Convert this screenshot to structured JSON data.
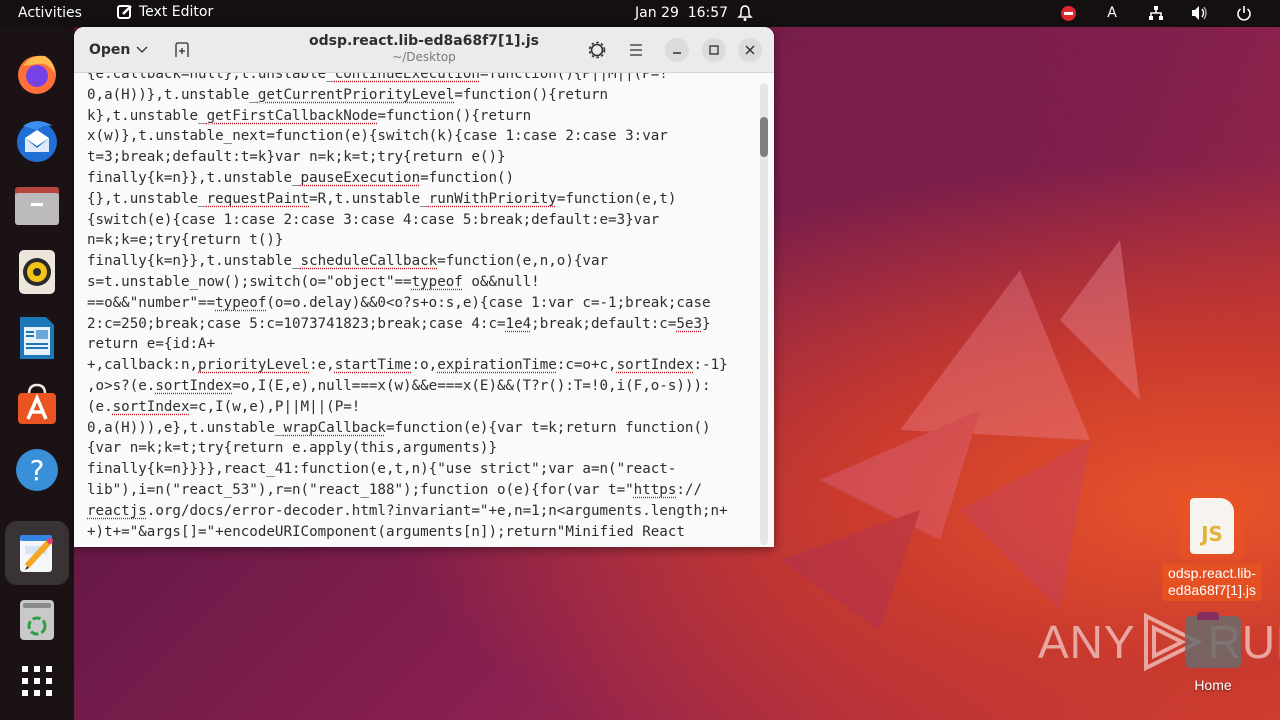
{
  "topbar": {
    "activities": "Activities",
    "app_name": "Text Editor",
    "datetime": "Jan 29  16:57",
    "tray": {
      "input_source": "A"
    }
  },
  "dock": {
    "items": [
      {
        "name": "Firefox",
        "icon": "firefox-icon"
      },
      {
        "name": "Thunderbird",
        "icon": "thunderbird-icon"
      },
      {
        "name": "Files",
        "icon": "files-icon"
      },
      {
        "name": "Rhythmbox",
        "icon": "rhythmbox-icon"
      },
      {
        "name": "LibreOffice Writer",
        "icon": "writer-icon"
      },
      {
        "name": "Ubuntu Software",
        "icon": "software-icon"
      },
      {
        "name": "Help",
        "icon": "help-icon"
      },
      {
        "name": "Text Editor",
        "icon": "text-editor-icon",
        "running": true,
        "active": true
      },
      {
        "name": "Trash",
        "icon": "trash-icon"
      },
      {
        "name": "Show Applications",
        "icon": "app-grid-icon"
      }
    ]
  },
  "window": {
    "open_label": "Open",
    "title": "odsp.react.lib-ed8a68f7[1].js",
    "subtitle": "~/Desktop",
    "scroll_position_fraction": 0.08
  },
  "editor": {
    "lines": [
      [
        {
          "t": "{e.callback=null},t.unstable_"
        },
        {
          "t": "continueExecution",
          "u": true
        },
        {
          "t": "=function(){P||M||(P=!"
        }
      ],
      [
        {
          "t": "0,a(H))},t.unstable_"
        },
        {
          "t": "getCurrentPriorityLevel",
          "u": true
        },
        {
          "t": "=function(){return"
        }
      ],
      [
        {
          "t": "k},t.unstable_"
        },
        {
          "t": "getFirstCallbackNode",
          "u": true
        },
        {
          "t": "=function(){return"
        }
      ],
      [
        {
          "t": "x(w)},t.unstable_next=function(e){switch(k){case 1:case 2:case 3:var"
        }
      ],
      [
        {
          "t": "t=3;break;default:t=k}var n=k;k=t;try{return e()}"
        }
      ],
      [
        {
          "t": "finally{k=n}},t.unstable_"
        },
        {
          "t": "pauseExecution",
          "u": true
        },
        {
          "t": "=function()"
        }
      ],
      [
        {
          "t": "{},t.unstable_"
        },
        {
          "t": "requestPaint",
          "u": true
        },
        {
          "t": "=R,t.unstable_"
        },
        {
          "t": "runWithPriority",
          "u": true
        },
        {
          "t": "=function(e,t)"
        }
      ],
      [
        {
          "t": "{switch(e){case 1:case 2:case 3:case 4:case 5:break;default:e=3}var"
        }
      ],
      [
        {
          "t": "n=k;k=e;try{return t()}"
        }
      ],
      [
        {
          "t": "finally{k=n}},t.unstable_"
        },
        {
          "t": "scheduleCallback",
          "u": true
        },
        {
          "t": "=function(e,n,o){var"
        }
      ],
      [
        {
          "t": "s=t.unstable_now();switch(o=\"object\"=="
        },
        {
          "t": "typeof",
          "u": true
        },
        {
          "t": " o&&null!"
        }
      ],
      [
        {
          "t": "==o&&\"number\"=="
        },
        {
          "t": "typeof",
          "u": true
        },
        {
          "t": "(o=o.delay)&&0<o?s+o:s,e){case 1:var c=-1;break;case"
        }
      ],
      [
        {
          "t": "2:c=250;break;case 5:c=1073741823;break;case 4:c="
        },
        {
          "t": "1e4",
          "u": true
        },
        {
          "t": ";break;default:c="
        },
        {
          "t": "5e3",
          "u": true
        },
        {
          "t": "}"
        }
      ],
      [
        {
          "t": "return e={id:A+"
        }
      ],
      [
        {
          "t": "+,callback:n,"
        },
        {
          "t": "priorityLevel",
          "u": true
        },
        {
          "t": ":e,"
        },
        {
          "t": "startTime",
          "u": true
        },
        {
          "t": ":o,"
        },
        {
          "t": "expirationTime",
          "u": true
        },
        {
          "t": ":c=o+c,"
        },
        {
          "t": "sortIndex",
          "u": true
        },
        {
          "t": ":-1}"
        }
      ],
      [
        {
          "t": ",o>s?(e."
        },
        {
          "t": "sortIndex",
          "u": true
        },
        {
          "t": "=o,I(E,e),null===x(w)&&e===x(E)&&(T?r():T=!0,i(F,o-s))):"
        }
      ],
      [
        {
          "t": "(e."
        },
        {
          "t": "sortIndex",
          "u": true
        },
        {
          "t": "=c,I(w,e),P||M||(P=!"
        }
      ],
      [
        {
          "t": "0,a(H))),e},t.unstable_"
        },
        {
          "t": "wrapCallback",
          "u": true
        },
        {
          "t": "=function(e){var t=k;return function()"
        }
      ],
      [
        {
          "t": "{var n=k;k=t;try{return e.apply(this,arguments)}"
        }
      ],
      [
        {
          "t": "finally{k=n}}}},react_41:function(e,t,n){\"use strict\";var a=n(\"react-"
        }
      ],
      [
        {
          "t": "lib\"),i=n(\"react_53\"),r=n(\"react_188\");function o(e){for(var t=\""
        },
        {
          "t": "https",
          "u": true
        },
        {
          "t": "://"
        }
      ],
      [
        {
          "t": "reactjs",
          "u": true
        },
        {
          "t": ".org/docs/error-decoder.html?invariant=\"+e,n=1;n<arguments.length;n+"
        }
      ],
      [
        {
          "t": "+)t+=\"&args[]=\"+encodeURIComponent(arguments[n]);return\"Minified React"
        }
      ]
    ]
  },
  "desktop": {
    "file_icon_text": "JS",
    "file_label": "odsp.react.lib-\ned8a68f7[1].js",
    "home_label": "Home"
  },
  "watermark": {
    "left": "ANY",
    "right": "RUN"
  }
}
